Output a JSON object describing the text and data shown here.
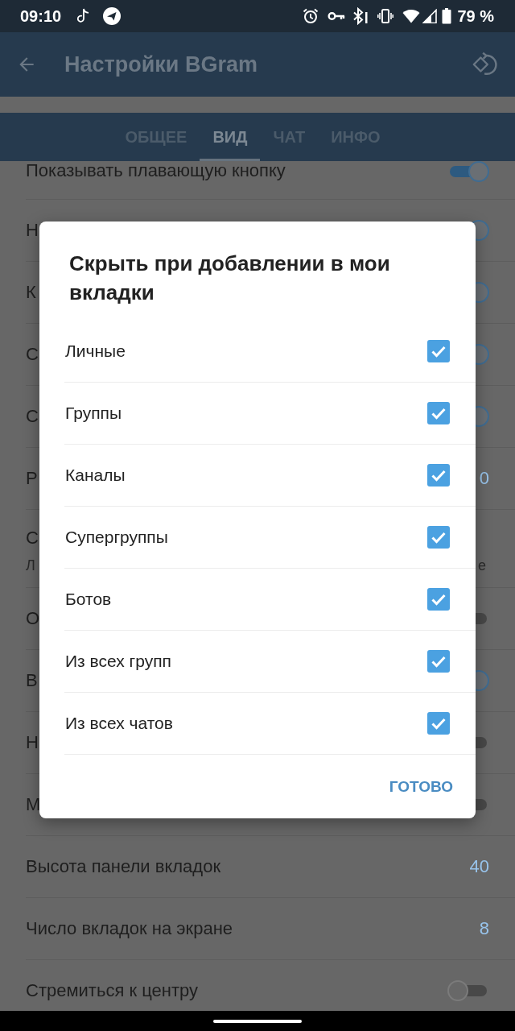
{
  "status_bar": {
    "time": "09:10",
    "battery": "79 %"
  },
  "app_bar": {
    "title": "Настройки BGram"
  },
  "tabs": [
    {
      "label": "ОБЩЕЕ",
      "selected": false
    },
    {
      "label": "ВИД",
      "selected": true
    },
    {
      "label": "ЧАТ",
      "selected": false
    },
    {
      "label": "ИНФО",
      "selected": false
    }
  ],
  "settings": [
    {
      "kind": "toggle",
      "label": "Показывать плавающую кнопку",
      "on": true
    },
    {
      "kind": "toggle",
      "label": "Н",
      "on": true
    },
    {
      "kind": "toggle",
      "label": "К",
      "on": true
    },
    {
      "kind": "toggle",
      "label": "С",
      "on": true
    },
    {
      "kind": "toggle",
      "label": "С",
      "on": true
    },
    {
      "kind": "value",
      "label": "Р",
      "value": "0"
    },
    {
      "kind": "text",
      "label": "С",
      "subtitle": "Л",
      "subtitle_end": "е"
    },
    {
      "kind": "toggle",
      "label": "О",
      "on": false
    },
    {
      "kind": "toggle",
      "label": "В",
      "on": true
    },
    {
      "kind": "toggle",
      "label": "Н",
      "on": false
    },
    {
      "kind": "toggle",
      "label": "М",
      "on": false
    },
    {
      "kind": "value",
      "label": "Высота панели вкладок",
      "value": "40"
    },
    {
      "kind": "value",
      "label": "Число вкладок на экране",
      "value": "8"
    },
    {
      "kind": "toggle",
      "label": "Стремиться к центру",
      "on": false
    }
  ],
  "dialog": {
    "title": "Скрыть при добавлении в мои вкладки",
    "options": [
      {
        "label": "Личные",
        "checked": true
      },
      {
        "label": "Группы",
        "checked": true
      },
      {
        "label": "Каналы",
        "checked": true
      },
      {
        "label": "Супергруппы",
        "checked": true
      },
      {
        "label": "Ботов",
        "checked": true
      },
      {
        "label": "Из всех групп",
        "checked": true
      },
      {
        "label": "Из всех чатов",
        "checked": true
      }
    ],
    "button": "ГОТОВО"
  }
}
